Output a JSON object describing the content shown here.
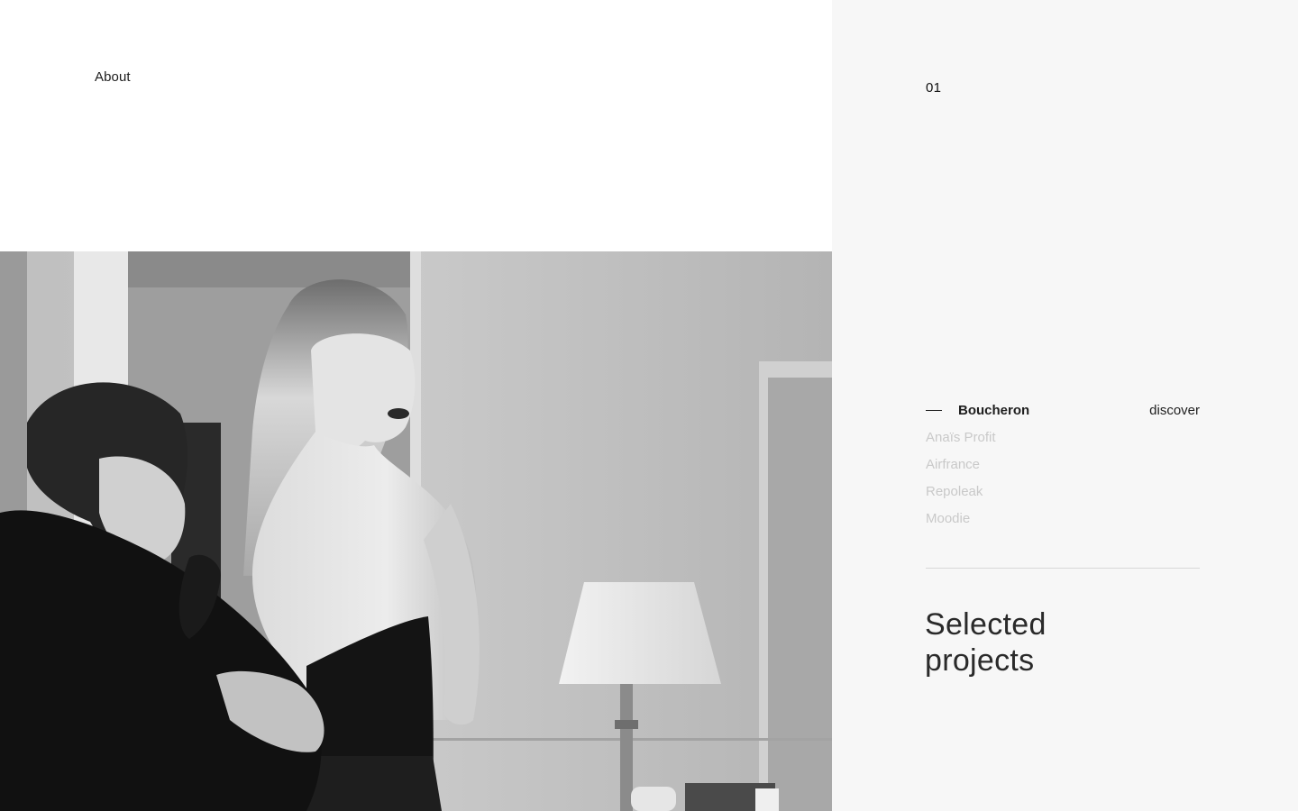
{
  "nav": {
    "about_label": "About"
  },
  "slider": {
    "counter": "01"
  },
  "projects": {
    "items": [
      {
        "label": "Boucheron",
        "active": true
      },
      {
        "label": "Anaïs Profit",
        "active": false
      },
      {
        "label": "Airfrance",
        "active": false
      },
      {
        "label": "Repoleak",
        "active": false
      },
      {
        "label": "Moodie",
        "active": false
      }
    ],
    "discover_label": "discover",
    "section_title_line1": "Selected",
    "section_title_line2": "projects"
  },
  "colors": {
    "panel_background": "#f7f7f7",
    "text_dark": "#1e1e1e",
    "text_muted": "#c9c9c9"
  }
}
